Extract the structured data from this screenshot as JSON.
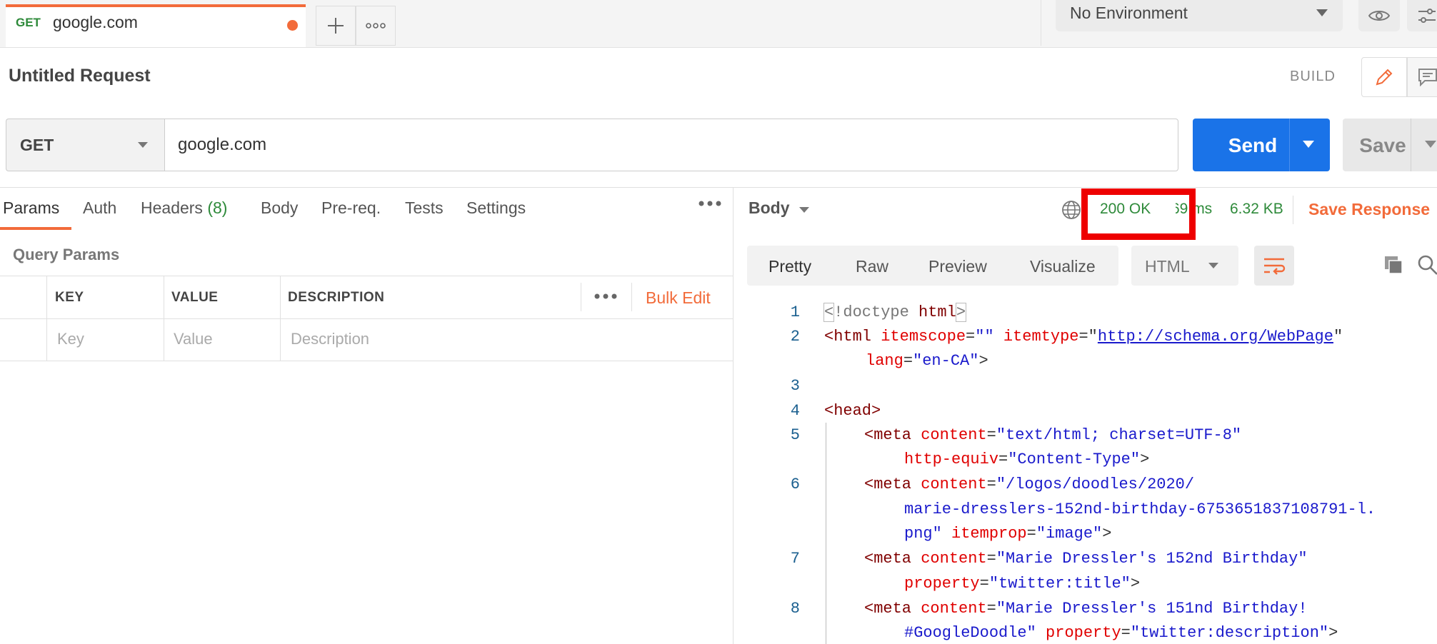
{
  "tab": {
    "method": "GET",
    "title": "google.com"
  },
  "environment": {
    "label": "No Environment"
  },
  "request": {
    "title": "Untitled Request",
    "mode": "BUILD"
  },
  "url_bar": {
    "method": "GET",
    "url": "google.com",
    "send": "Send",
    "save": "Save"
  },
  "left_tabs": {
    "params": "Params",
    "auth": "Auth",
    "headers": "Headers",
    "headers_count": "(8)",
    "body": "Body",
    "prereq": "Pre-req.",
    "tests": "Tests",
    "settings": "Settings"
  },
  "query_params": {
    "title": "Query Params",
    "columns": {
      "key": "KEY",
      "value": "VALUE",
      "description": "DESCRIPTION"
    },
    "placeholders": {
      "key": "Key",
      "value": "Value",
      "description": "Description"
    },
    "bulk_edit": "Bulk Edit"
  },
  "response": {
    "body_label": "Body",
    "status": "200 OK",
    "time": "69 ms",
    "size": "6.32 KB",
    "save_response": "Save Response",
    "formats": {
      "pretty": "Pretty",
      "raw": "Raw",
      "preview": "Preview",
      "visualize": "Visualize"
    },
    "language": "HTML"
  },
  "code": {
    "line_numbers": [
      "1",
      "2",
      "3",
      "4",
      "5",
      "6",
      "7",
      "8"
    ],
    "l1_lt": "<",
    "l1_doctype": "!doctype ",
    "l1_html": "html",
    "l1_gt": ">",
    "l2_open": "<html ",
    "l2_attr1": "itemscope",
    "l2_eq1": "=",
    "l2_val1": "\"\"",
    "l2_sp": " ",
    "l2_attr2": "itemtype",
    "l2_eq2": "=\"",
    "l2_link": "http://schema.org/WebPage",
    "l2_q": "\"",
    "l2b_attr": "lang",
    "l2b_eq": "=",
    "l2b_val": "\"en-CA\"",
    "l2b_gt": ">",
    "l4": "<head>",
    "l5_open": "<meta ",
    "l5_attr": "content",
    "l5_eq": "=",
    "l5_val": "\"text/html; charset=UTF-8\"",
    "l5b_attr": "http-equiv",
    "l5b_eq": "=",
    "l5b_val": "\"Content-Type\"",
    "l5b_gt": ">",
    "l6_open": "<meta ",
    "l6_attr": "content",
    "l6_eq": "=",
    "l6_val": "\"/logos/doodles/2020/",
    "l6b_val": "marie-dresslers-152nd-birthday-6753651837108791-l.",
    "l6c_val": "png\"",
    "l6c_attr": "itemprop",
    "l6c_eq": "=",
    "l6c_val2": "\"image\"",
    "l6c_gt": ">",
    "l7_open": "<meta ",
    "l7_attr": "content",
    "l7_eq": "=",
    "l7_val": "\"Marie Dressler's 152nd Birthday\"",
    "l7b_attr": "property",
    "l7b_eq": "=",
    "l7b_val": "\"twitter:title\"",
    "l7b_gt": ">",
    "l8_open": "<meta ",
    "l8_attr": "content",
    "l8_eq": "=",
    "l8_val": "\"Marie Dressler's 151nd Birthday!",
    "l8b_val": "#GoogleDoodle\"",
    "l8b_attr": "property",
    "l8b_eq": "=",
    "l8b_val2": "\"twitter:description\"",
    "l8b_gt": ">"
  },
  "colors": {
    "accent": "#f26b3a",
    "send": "#1a73e8",
    "status_ok": "#2e8a3a",
    "highlight": "#ee0000"
  }
}
